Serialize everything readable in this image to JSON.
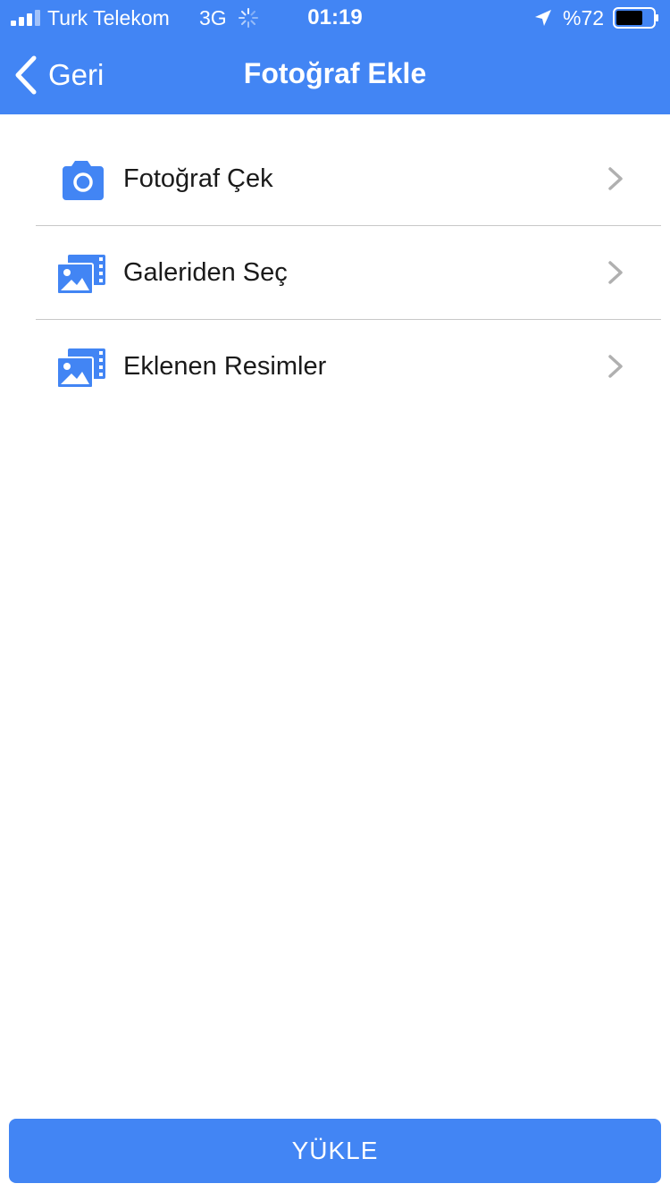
{
  "status_bar": {
    "carrier": "Turk Telekom",
    "network": "3G",
    "time": "01:19",
    "battery_percent": "%72",
    "battery_level": 0.72,
    "icons": [
      "signal-bars-icon",
      "loading-spinner-icon",
      "location-arrow-icon",
      "battery-icon"
    ]
  },
  "nav": {
    "back_label": "Geri",
    "title": "Fotoğraf Ekle"
  },
  "menu": {
    "items": [
      {
        "label": "Fotoğraf Çek",
        "icon": "camera-icon"
      },
      {
        "label": "Galeriden Seç",
        "icon": "gallery-icon"
      },
      {
        "label": "Eklenen Resimler",
        "icon": "gallery-icon"
      }
    ]
  },
  "upload_button": {
    "label": "YÜKLE"
  },
  "colors": {
    "primary": "#4285F4",
    "text": "#1a1a1a",
    "chevron": "#b0b0b0",
    "divider": "#c8c8c8"
  }
}
